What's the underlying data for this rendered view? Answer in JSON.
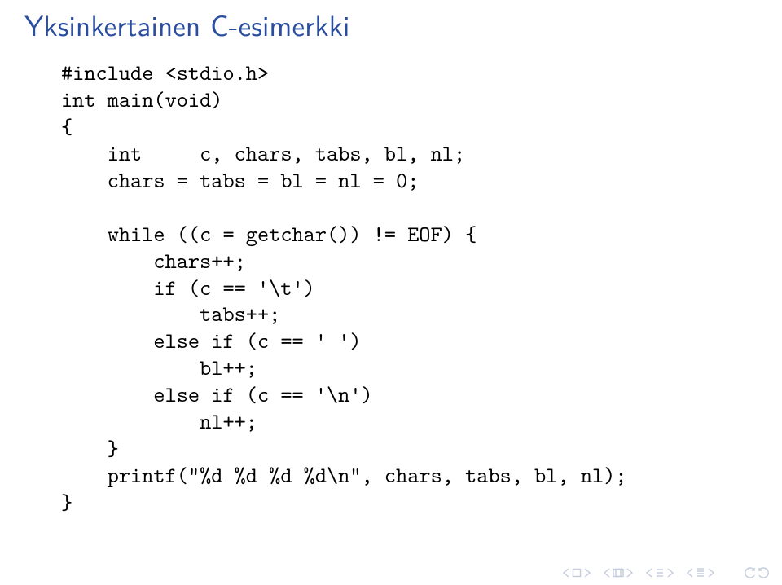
{
  "title": "Yksinkertainen C-esimerkki",
  "code": {
    "l1": "#include <stdio.h>",
    "l2": "int main(void)",
    "l3": "{",
    "l4": "    int     c, chars, tabs, bl, nl;",
    "l5": "    chars = tabs = bl = nl = 0;",
    "l6": "",
    "l7": "    while ((c = getchar()) != EOF) {",
    "l8": "        chars++;",
    "l9": "        if (c == '\\t')",
    "l10": "            tabs++;",
    "l11": "        else if (c == ' ')",
    "l12": "            bl++;",
    "l13": "        else if (c == '\\n')",
    "l14": "            nl++;",
    "l15": "    }",
    "l16": "    printf(\"%d %d %d %d\\n\", chars, tabs, bl, nl);",
    "l17": "}"
  }
}
